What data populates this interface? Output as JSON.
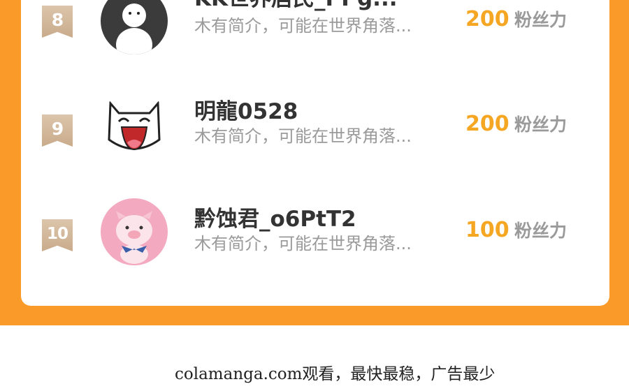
{
  "ranking": {
    "rows": [
      {
        "rank": "8",
        "name": "KK世界居民_PPg...",
        "bio": "木有简介，可能在世界角落...",
        "score": "200",
        "unit": "粉丝力",
        "avatar_icon": "white-figure-avatar-icon"
      },
      {
        "rank": "9",
        "name": "明龍0528",
        "bio": "木有简介，可能在世界角落...",
        "score": "200",
        "unit": "粉丝力",
        "avatar_icon": "laughing-cat-avatar-icon"
      },
      {
        "rank": "10",
        "name": "黔蚀君_o6PtT2",
        "bio": "木有简介，可能在世界角落...",
        "score": "100",
        "unit": "粉丝力",
        "avatar_icon": "pink-pig-avatar-icon"
      }
    ]
  },
  "footer": {
    "text": "colamanga.com观看，最快最稳，广告最少"
  },
  "colors": {
    "frame": "#fa9a28",
    "score": "#f5a623",
    "rank_badge": "#cfb293"
  }
}
